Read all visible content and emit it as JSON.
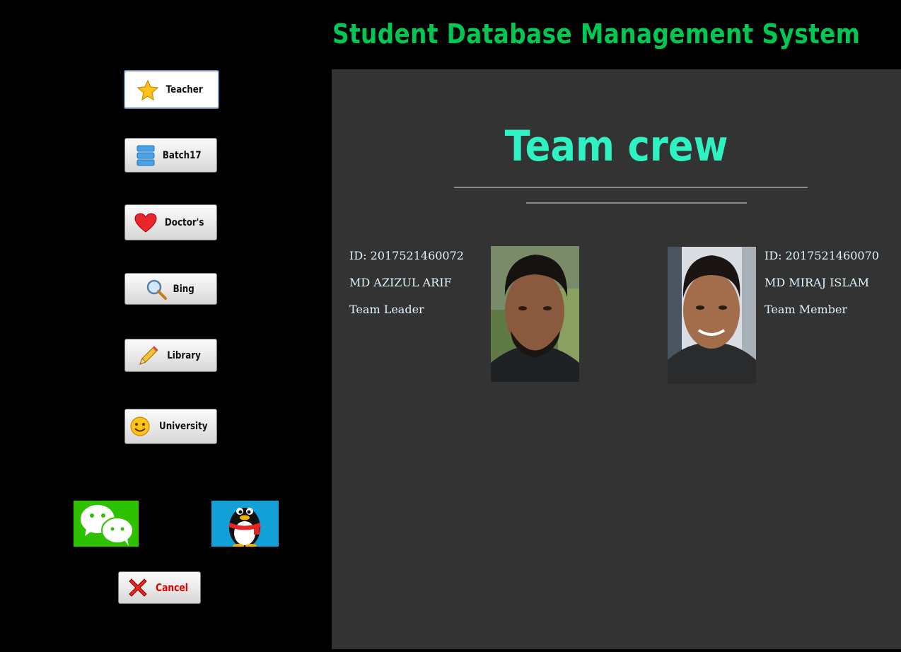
{
  "app": {
    "title": "Student Database Management System"
  },
  "sidebar": {
    "buttons": [
      {
        "label": "Teacher",
        "icon": "star-icon"
      },
      {
        "label": "Batch17",
        "icon": "database-icon"
      },
      {
        "label": "Doctor's",
        "icon": "heart-icon"
      },
      {
        "label": "Bing",
        "icon": "magnifier-icon"
      },
      {
        "label": "Library",
        "icon": "pencil-icon"
      },
      {
        "label": "University",
        "icon": "smiley-icon"
      }
    ],
    "social": [
      {
        "icon": "wechat-icon",
        "color": "#2dc100"
      },
      {
        "icon": "qq-penguin-icon",
        "color": "#12a0d6"
      }
    ],
    "cancel_label": "Cancel"
  },
  "panel": {
    "title": "Team crew",
    "members": [
      {
        "id": "ID: 2017521460072",
        "name": "MD AZIZUL ARIF",
        "role": "Team Leader"
      },
      {
        "id": "ID: 2017521460070",
        "name": "MD MIRAJ ISLAM",
        "role": "Team Member"
      }
    ]
  },
  "colors": {
    "title": "#00c853",
    "panel_title": "#2ef2c2",
    "panel_bg": "#333333",
    "cancel_text": "#e00000"
  }
}
